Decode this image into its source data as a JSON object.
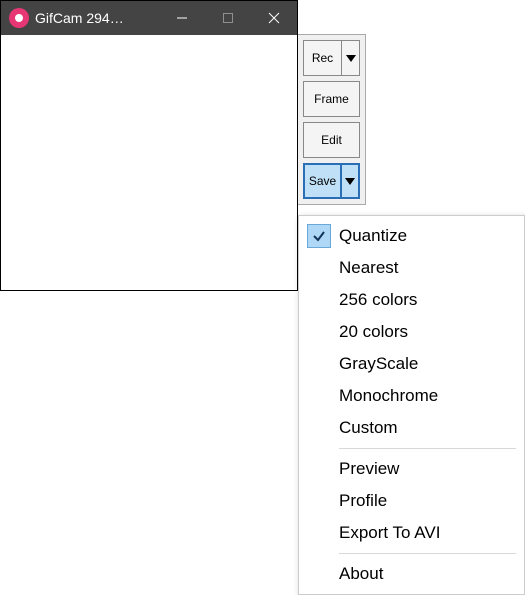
{
  "window": {
    "title": "GifCam 294…"
  },
  "toolbar": {
    "rec": "Rec",
    "frame": "Frame",
    "edit": "Edit",
    "save": "Save"
  },
  "saveMenu": {
    "group1": [
      {
        "label": "Quantize",
        "checked": true
      },
      {
        "label": "Nearest",
        "checked": false
      },
      {
        "label": "256 colors",
        "checked": false
      },
      {
        "label": "20 colors",
        "checked": false
      },
      {
        "label": "GrayScale",
        "checked": false
      },
      {
        "label": "Monochrome",
        "checked": false
      },
      {
        "label": "Custom",
        "checked": false
      }
    ],
    "group2": [
      {
        "label": "Preview"
      },
      {
        "label": "Profile"
      },
      {
        "label": "Export To AVI"
      }
    ],
    "group3": [
      {
        "label": "About"
      }
    ]
  }
}
